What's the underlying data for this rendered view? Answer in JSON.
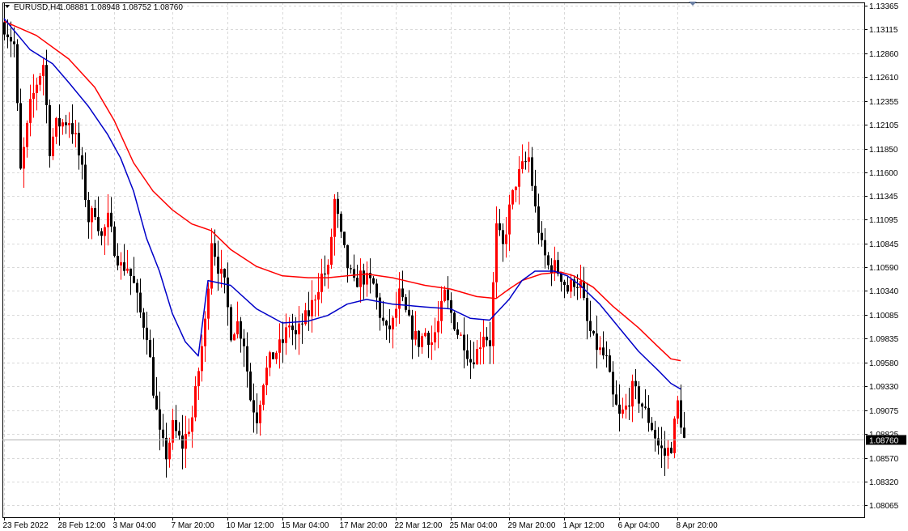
{
  "header": {
    "symbol": "EURUSD,H4",
    "quote": "1.08881 1.08948 1.08752 1.08760"
  },
  "colors": {
    "bull": "#ff0000",
    "bear": "#000000",
    "ma_fast": "#0000c8",
    "ma_slow": "#ff0000",
    "grid": "#d9d9d9",
    "price_tag_bg": "#000000",
    "price_tag_fg": "#ffffff"
  },
  "chart_data": {
    "type": "candlestick",
    "grid": true,
    "ylim": [
      1.0794,
      1.134
    ],
    "x_count": 211,
    "y_ticks": [
      1.13365,
      1.13115,
      1.1286,
      1.1261,
      1.12355,
      1.12105,
      1.1185,
      1.116,
      1.11345,
      1.11095,
      1.10845,
      1.1059,
      1.1034,
      1.10085,
      1.09835,
      1.0958,
      1.0933,
      1.09075,
      1.08825,
      1.0857,
      1.0832,
      1.08065
    ],
    "y_tick_labels": [
      "1.13365",
      "1.13115",
      "1.12860",
      "1.12610",
      "1.12355",
      "1.12105",
      "1.11850",
      "1.11600",
      "1.11345",
      "1.11095",
      "1.10845",
      "1.10590",
      "1.10340",
      "1.10085",
      "1.09835",
      "1.09580",
      "1.09330",
      "1.09075",
      "1.08825",
      "1.08570",
      "1.08320",
      "1.08065"
    ],
    "x_tick_labels": [
      {
        "bar": 0,
        "label": "23 Feb 2022"
      },
      {
        "bar": 17,
        "label": "28 Feb 12:00"
      },
      {
        "bar": 34,
        "label": "3 Mar 04:00"
      },
      {
        "bar": 52,
        "label": "7 Mar 20:00"
      },
      {
        "bar": 69,
        "label": "10 Mar 12:00"
      },
      {
        "bar": 86,
        "label": "15 Mar 04:00"
      },
      {
        "bar": 104,
        "label": "17 Mar 20:00"
      },
      {
        "bar": 121,
        "label": "22 Mar 12:00"
      },
      {
        "bar": 138,
        "label": "25 Mar 04:00"
      },
      {
        "bar": 156,
        "label": "29 Mar 20:00"
      },
      {
        "bar": 173,
        "label": "1 Apr 12:00"
      },
      {
        "bar": 190,
        "label": "6 Apr 04:00"
      },
      {
        "bar": 208,
        "label": "8 Apr 20:00"
      }
    ],
    "current_price": 1.0876,
    "current_price_label": "1.08760",
    "anchors": [
      [
        0,
        1.1315
      ],
      [
        3,
        1.1295
      ],
      [
        5,
        1.116
      ],
      [
        8,
        1.123
      ],
      [
        10,
        1.1255
      ],
      [
        12,
        1.1275
      ],
      [
        14,
        1.1185
      ],
      [
        16,
        1.121
      ],
      [
        20,
        1.1215
      ],
      [
        22,
        1.1195
      ],
      [
        24,
        1.116
      ],
      [
        26,
        1.111
      ],
      [
        28,
        1.112
      ],
      [
        30,
        1.109
      ],
      [
        32,
        1.111
      ],
      [
        34,
        1.108
      ],
      [
        36,
        1.106
      ],
      [
        38,
        1.106
      ],
      [
        40,
        1.104
      ],
      [
        42,
        1.101
      ],
      [
        44,
        1.099
      ],
      [
        46,
        1.093
      ],
      [
        48,
        1.088
      ],
      [
        50,
        1.086
      ],
      [
        52,
        1.089
      ],
      [
        55,
        1.087
      ],
      [
        58,
        1.09
      ],
      [
        60,
        1.095
      ],
      [
        62,
        1.1
      ],
      [
        64,
        1.109
      ],
      [
        66,
        1.106
      ],
      [
        68,
        1.104
      ],
      [
        70,
        1.099
      ],
      [
        72,
        1.1
      ],
      [
        74,
        1.098
      ],
      [
        76,
        1.092
      ],
      [
        78,
        1.09
      ],
      [
        80,
        1.094
      ],
      [
        82,
        1.096
      ],
      [
        84,
        1.097
      ],
      [
        86,
        1.098
      ],
      [
        88,
        1.1
      ],
      [
        90,
        1.0985
      ],
      [
        92,
        1.1
      ],
      [
        94,
        1.101
      ],
      [
        96,
        1.103
      ],
      [
        98,
        1.105
      ],
      [
        100,
        1.1055
      ],
      [
        102,
        1.113
      ],
      [
        104,
        1.109
      ],
      [
        106,
        1.106
      ],
      [
        108,
        1.104
      ],
      [
        110,
        1.105
      ],
      [
        112,
        1.1045
      ],
      [
        114,
        1.104
      ],
      [
        116,
        1.101
      ],
      [
        118,
        1.099
      ],
      [
        120,
        1.1
      ],
      [
        122,
        1.103
      ],
      [
        124,
        1.101
      ],
      [
        126,
        1.099
      ],
      [
        128,
        1.098
      ],
      [
        130,
        1.099
      ],
      [
        132,
        1.098
      ],
      [
        134,
        1.1
      ],
      [
        136,
        1.103
      ],
      [
        138,
        1.101
      ],
      [
        140,
        1.099
      ],
      [
        142,
        1.098
      ],
      [
        144,
        1.096
      ],
      [
        146,
        1.097
      ],
      [
        148,
        1.099
      ],
      [
        150,
        1.098
      ],
      [
        152,
        1.11
      ],
      [
        154,
        1.108
      ],
      [
        156,
        1.112
      ],
      [
        158,
        1.115
      ],
      [
        160,
        1.1165
      ],
      [
        162,
        1.1175
      ],
      [
        164,
        1.112
      ],
      [
        166,
        1.108
      ],
      [
        168,
        1.106
      ],
      [
        170,
        1.106
      ],
      [
        172,
        1.105
      ],
      [
        174,
        1.1035
      ],
      [
        176,
        1.1045
      ],
      [
        178,
        1.104
      ],
      [
        180,
        1.1
      ],
      [
        182,
        1.098
      ],
      [
        184,
        1.097
      ],
      [
        186,
        1.096
      ],
      [
        188,
        1.092
      ],
      [
        190,
        1.09
      ],
      [
        192,
        1.091
      ],
      [
        194,
        1.093
      ],
      [
        196,
        1.092
      ],
      [
        198,
        1.0905
      ],
      [
        200,
        1.089
      ],
      [
        202,
        1.087
      ],
      [
        204,
        1.086
      ],
      [
        206,
        1.087
      ],
      [
        208,
        1.0915
      ],
      [
        210,
        1.0876
      ]
    ],
    "ma_fast": [
      [
        0,
        1.1323
      ],
      [
        8,
        1.129
      ],
      [
        15,
        1.1275
      ],
      [
        20,
        1.1255
      ],
      [
        26,
        1.123
      ],
      [
        32,
        1.12
      ],
      [
        36,
        1.1175
      ],
      [
        40,
        1.114
      ],
      [
        44,
        1.109
      ],
      [
        48,
        1.1055
      ],
      [
        52,
        1.101
      ],
      [
        56,
        1.098
      ],
      [
        60,
        1.0965
      ],
      [
        63,
        1.1045
      ],
      [
        70,
        1.104
      ],
      [
        78,
        1.1015
      ],
      [
        86,
        1.1
      ],
      [
        94,
        1.1002
      ],
      [
        100,
        1.1008
      ],
      [
        106,
        1.102
      ],
      [
        112,
        1.1025
      ],
      [
        120,
        1.102
      ],
      [
        130,
        1.1017
      ],
      [
        138,
        1.1015
      ],
      [
        144,
        1.1005
      ],
      [
        150,
        1.1003
      ],
      [
        156,
        1.1025
      ],
      [
        160,
        1.1045
      ],
      [
        164,
        1.1055
      ],
      [
        170,
        1.1055
      ],
      [
        174,
        1.105
      ],
      [
        178,
        1.104
      ],
      [
        184,
        1.102
      ],
      [
        190,
        1.0995
      ],
      [
        196,
        1.097
      ],
      [
        202,
        1.095
      ],
      [
        206,
        1.0936
      ],
      [
        209,
        1.093
      ]
    ],
    "ma_slow": [
      [
        0,
        1.132
      ],
      [
        10,
        1.1305
      ],
      [
        20,
        1.128
      ],
      [
        28,
        1.125
      ],
      [
        34,
        1.1215
      ],
      [
        40,
        1.117
      ],
      [
        46,
        1.114
      ],
      [
        52,
        1.112
      ],
      [
        58,
        1.1105
      ],
      [
        64,
        1.1098
      ],
      [
        70,
        1.1078
      ],
      [
        78,
        1.106
      ],
      [
        86,
        1.105
      ],
      [
        94,
        1.1048
      ],
      [
        100,
        1.1048
      ],
      [
        106,
        1.105
      ],
      [
        112,
        1.1052
      ],
      [
        120,
        1.1048
      ],
      [
        130,
        1.104
      ],
      [
        138,
        1.1036
      ],
      [
        146,
        1.1028
      ],
      [
        152,
        1.1026
      ],
      [
        156,
        1.1036
      ],
      [
        160,
        1.1045
      ],
      [
        166,
        1.1052
      ],
      [
        172,
        1.1054
      ],
      [
        176,
        1.105
      ],
      [
        182,
        1.1038
      ],
      [
        188,
        1.1018
      ],
      [
        196,
        1.0995
      ],
      [
        202,
        1.0975
      ],
      [
        206,
        1.0962
      ],
      [
        209,
        1.096
      ]
    ]
  }
}
